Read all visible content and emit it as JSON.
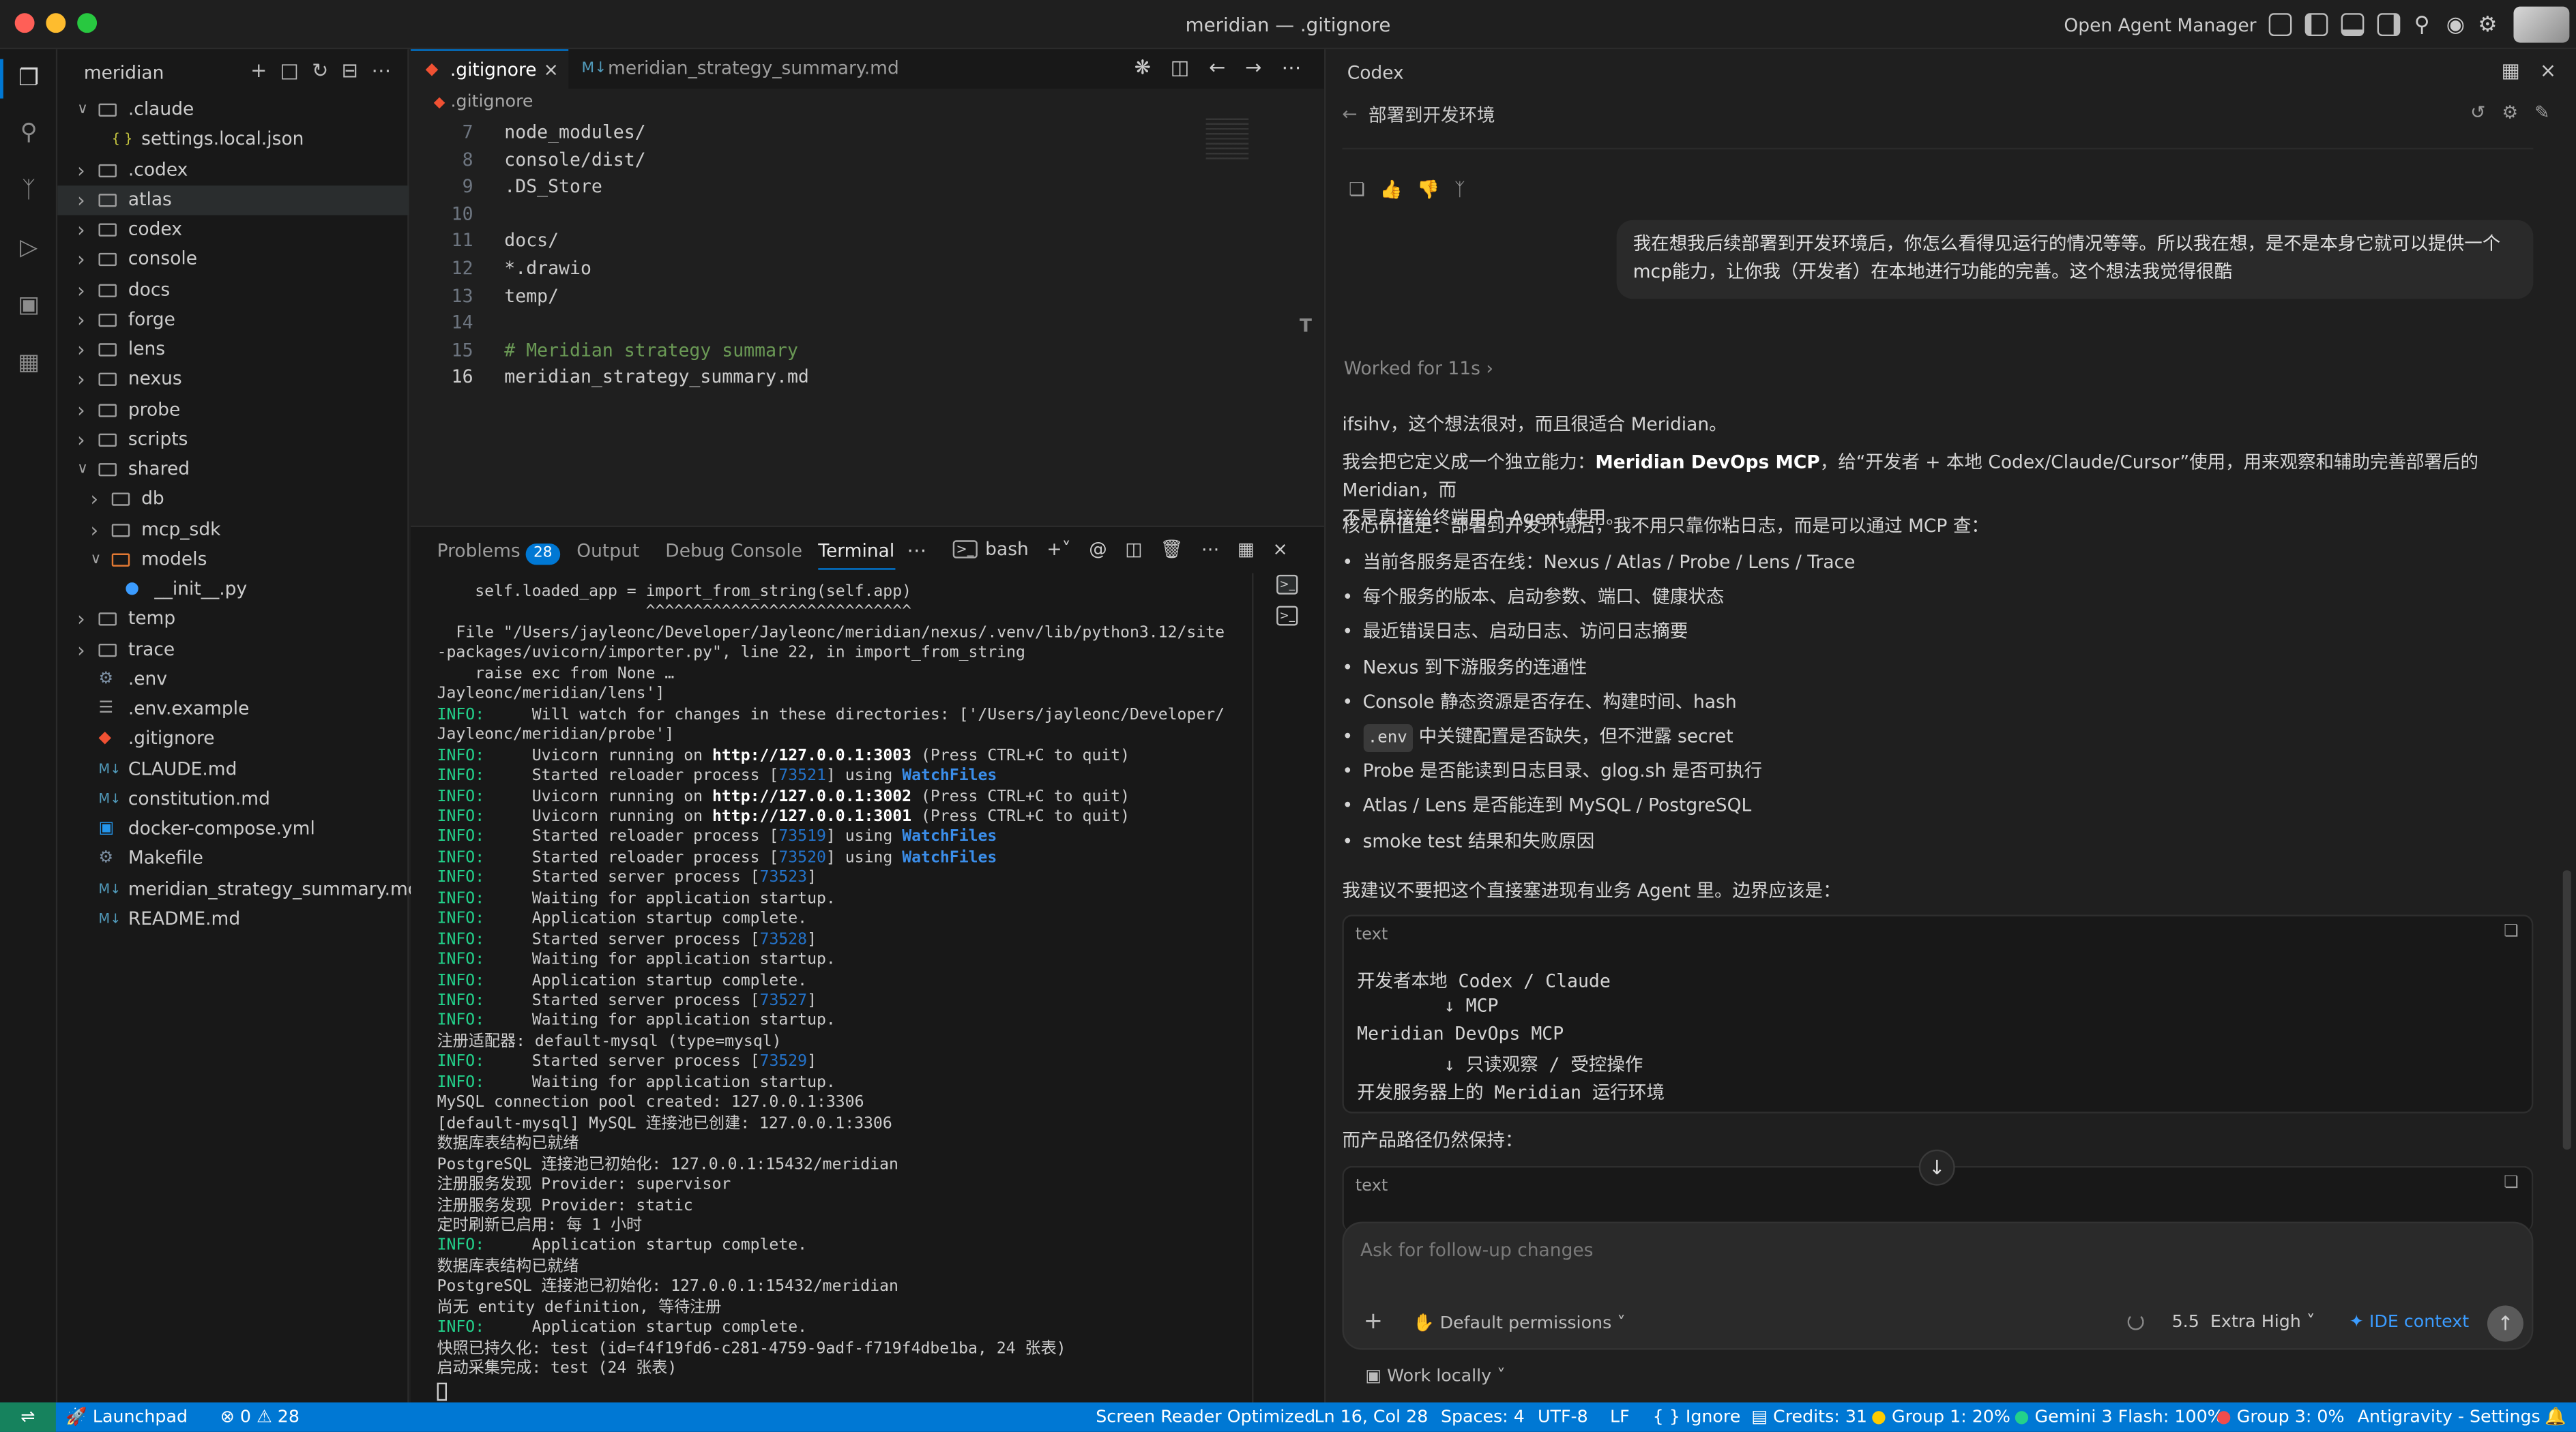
{
  "window": {
    "title": "meridian — .gitignore"
  },
  "titlebar": {
    "agent_manager": "Open Agent Manager"
  },
  "explorer": {
    "title": "meridian",
    "items": [
      {
        "label": ".claude",
        "icon": "folder-icon",
        "level": 0,
        "twisty": "v"
      },
      {
        "label": "settings.local.json",
        "icon": "json-file-icon",
        "level": 1,
        "twisty": ""
      },
      {
        "label": ".codex",
        "icon": "folder-icon",
        "level": 0,
        "twisty": ">"
      },
      {
        "label": "atlas",
        "icon": "folder-icon",
        "level": 0,
        "twisty": ">",
        "selected": true
      },
      {
        "label": "codex",
        "icon": "folder-icon",
        "level": 0,
        "twisty": ">"
      },
      {
        "label": "console",
        "icon": "folder-icon",
        "level": 0,
        "twisty": ">"
      },
      {
        "label": "docs",
        "icon": "folder-icon",
        "level": 0,
        "twisty": ">"
      },
      {
        "label": "forge",
        "icon": "folder-icon",
        "level": 0,
        "twisty": ">"
      },
      {
        "label": "lens",
        "icon": "folder-icon",
        "level": 0,
        "twisty": ">"
      },
      {
        "label": "nexus",
        "icon": "folder-icon",
        "level": 0,
        "twisty": ">"
      },
      {
        "label": "probe",
        "icon": "folder-icon",
        "level": 0,
        "twisty": ">"
      },
      {
        "label": "scripts",
        "icon": "folder-icon",
        "level": 0,
        "twisty": ">"
      },
      {
        "label": "shared",
        "icon": "folder-icon",
        "level": 0,
        "twisty": "v"
      },
      {
        "label": "db",
        "icon": "folder-icon",
        "level": 1,
        "twisty": ">"
      },
      {
        "label": "mcp_sdk",
        "icon": "folder-icon",
        "level": 1,
        "twisty": ">"
      },
      {
        "label": "models",
        "icon": "folder-icon",
        "level": 1,
        "twisty": "v"
      },
      {
        "label": "__init__.py",
        "icon": "python-file-icon",
        "level": 2,
        "twisty": ""
      },
      {
        "label": "temp",
        "icon": "folder-icon",
        "level": 0,
        "twisty": ">"
      },
      {
        "label": "trace",
        "icon": "folder-icon",
        "level": 0,
        "twisty": ">"
      },
      {
        "label": ".env",
        "icon": "gear-file-icon",
        "level": 0,
        "twisty": ""
      },
      {
        "label": ".env.example",
        "icon": "file-icon",
        "level": 0,
        "twisty": ""
      },
      {
        "label": ".gitignore",
        "icon": "git-file-icon",
        "level": 0,
        "twisty": ""
      },
      {
        "label": "CLAUDE.md",
        "icon": "markdown-file-icon",
        "level": 0,
        "twisty": ""
      },
      {
        "label": "constitution.md",
        "icon": "markdown-file-icon",
        "level": 0,
        "twisty": ""
      },
      {
        "label": "docker-compose.yml",
        "icon": "docker-file-icon",
        "level": 0,
        "twisty": ""
      },
      {
        "label": "Makefile",
        "icon": "gear-file-icon",
        "level": 0,
        "twisty": ""
      },
      {
        "label": "meridian_strategy_summary.md",
        "icon": "markdown-file-icon",
        "level": 0,
        "twisty": ""
      },
      {
        "label": "README.md",
        "icon": "markdown-file-icon",
        "level": 0,
        "twisty": ""
      }
    ]
  },
  "editor": {
    "tabs": [
      {
        "label": ".gitignore",
        "active": true
      },
      {
        "label": "meridian_strategy_summary.md",
        "active": false
      }
    ],
    "breadcrumb": ".gitignore",
    "lines": [
      {
        "n": "7",
        "text": "node_modules/"
      },
      {
        "n": "8",
        "text": "console/dist/"
      },
      {
        "n": "9",
        "text": ".DS_Store"
      },
      {
        "n": "10",
        "text": ""
      },
      {
        "n": "11",
        "text": "docs/"
      },
      {
        "n": "12",
        "text": "*.drawio"
      },
      {
        "n": "13",
        "text": "temp/"
      },
      {
        "n": "14",
        "text": ""
      },
      {
        "n": "15",
        "text": "# Meridian strategy summary",
        "comment": true
      },
      {
        "n": "16",
        "text": "meridian_strategy_summary.md",
        "current": true
      }
    ]
  },
  "panel": {
    "tabs": {
      "problems": "Problems",
      "problems_count": "28",
      "output": "Output",
      "debug": "Debug Console",
      "terminal": "Terminal",
      "shell": "bash"
    },
    "lines": [
      {
        "t": "    self.loaded_app = import_from_string(self.app)"
      },
      {
        "t": "                      ^^^^^^^^^^^^^^^^^^^^^^^^^^^^"
      },
      {
        "t": "  File \"/Users/jayleonc/Developer/Jayleonc/meridian/nexus/.venv/lib/python3.12/site"
      },
      {
        "t": "-packages/uvicorn/importer.py\", line 22, in import_from_string"
      },
      {
        "t": "    raise exc from None …"
      },
      {
        "t": "Jayleonc/meridian/lens']"
      },
      {
        "p": "INFO:",
        "t": "     Will watch for changes in these directories: ['/Users/jayleonc/Developer/"
      },
      {
        "t": "Jayleonc/meridian/probe']"
      },
      {
        "p": "INFO:",
        "t": "     Uvicorn running on ",
        "b": "http://127.0.0.1:3003",
        "r": " (Press CTRL+C to quit)"
      },
      {
        "p": "INFO:",
        "t": "     Started reloader process [",
        "n": "73521",
        "r": "] using ",
        "w": "WatchFiles"
      },
      {
        "p": "INFO:",
        "t": "     Uvicorn running on ",
        "b": "http://127.0.0.1:3002",
        "r": " (Press CTRL+C to quit)"
      },
      {
        "p": "INFO:",
        "t": "     Uvicorn running on ",
        "b": "http://127.0.0.1:3001",
        "r": " (Press CTRL+C to quit)"
      },
      {
        "p": "INFO:",
        "t": "     Started reloader process [",
        "n": "73519",
        "r": "] using ",
        "w": "WatchFiles"
      },
      {
        "p": "INFO:",
        "t": "     Started reloader process [",
        "n": "73520",
        "r": "] using ",
        "w": "WatchFiles"
      },
      {
        "p": "INFO:",
        "t": "     Started server process [",
        "n": "73523",
        "r": "]"
      },
      {
        "p": "INFO:",
        "t": "     Waiting for application startup."
      },
      {
        "p": "INFO:",
        "t": "     Application startup complete."
      },
      {
        "p": "INFO:",
        "t": "     Started server process [",
        "n": "73528",
        "r": "]"
      },
      {
        "p": "INFO:",
        "t": "     Waiting for application startup."
      },
      {
        "p": "INFO:",
        "t": "     Application startup complete."
      },
      {
        "p": "INFO:",
        "t": "     Started server process [",
        "n": "73527",
        "r": "]"
      },
      {
        "p": "INFO:",
        "t": "     Waiting for application startup."
      },
      {
        "t": "注册适配器: default-mysql (type=mysql)"
      },
      {
        "p": "INFO:",
        "t": "     Started server process [",
        "n": "73529",
        "r": "]"
      },
      {
        "p": "INFO:",
        "t": "     Waiting for application startup."
      },
      {
        "t": "MySQL connection pool created: 127.0.0.1:3306"
      },
      {
        "t": "[default-mysql] MySQL 连接池已创建: 127.0.0.1:3306"
      },
      {
        "t": "数据库表结构已就绪"
      },
      {
        "t": "PostgreSQL 连接池已初始化: 127.0.0.1:15432/meridian"
      },
      {
        "t": "注册服务发现 Provider: supervisor"
      },
      {
        "t": "注册服务发现 Provider: static"
      },
      {
        "t": "定时刷新已启用: 每 1 小时"
      },
      {
        "p": "INFO:",
        "t": "     Application startup complete."
      },
      {
        "t": "数据库表结构已就绪"
      },
      {
        "t": "PostgreSQL 连接池已初始化: 127.0.0.1:15432/meridian"
      },
      {
        "t": "尚无 entity definition, 等待注册"
      },
      {
        "p": "INFO:",
        "t": "     Application startup complete."
      },
      {
        "t": "快照已持久化: test (id=f4f19fd6-c281-4759-9adf-f719f4dbe1ba, 24 张表)"
      },
      {
        "t": "启动采集完成: test (24 张表)"
      }
    ]
  },
  "codex": {
    "title": "Codex",
    "thread": "部署到开发环境",
    "user_msg": "我在想我后续部署到开发环境后，你怎么看得见运行的情况等等。所以我在想，是不是本身它就可以提供一个mcp能力，让你我（开发者）在本地进行功能的完善。这个想法我觉得很酷",
    "worked": "Worked for 11s",
    "intro": "ifsihv，这个想法很对，而且很适合 Meridian。",
    "p1a": "我会把它定义成一个独立能力：",
    "p1b": "Meridian DevOps MCP",
    "p1c": "，给“开发者 + 本地 Codex/Claude/Cursor”使用，用来观察和辅助完善部署后的 Meridian，而",
    "p1d": "不是直接给终端用户 Agent 使用。",
    "p2": "核心价值是：部署到开发环境后，我不用只靠你粘日志，而是可以通过 MCP 查：",
    "bullets": [
      "当前各服务是否在线：Nexus / Atlas / Probe / Lens / Trace",
      "每个服务的版本、启动参数、端口、健康状态",
      "最近错误日志、启动日志、访问日志摘要",
      "Nexus 到下游服务的连通性",
      "Console 静态资源是否存在、构建时间、hash",
      "中关键配置是否缺失，但不泄露 secret",
      "Probe 是否能读到日志目录、glog.sh 是否可执行",
      "Atlas / Lens 是否能连到 MySQL / PostgreSQL",
      "smoke test 结果和失败原因"
    ],
    "env_chip": ".env",
    "p3": "我建议不要把这个直接塞进现有业务 Agent 里。边界应该是：",
    "code_label": "text",
    "code_lines": [
      "开发者本地 Codex / Claude",
      "        ↓ MCP",
      "Meridian DevOps MCP",
      "        ↓ 只读观察 / 受控操作",
      "开发服务器上的 Meridian 运行环境"
    ],
    "p4": "而产品路径仍然保持：",
    "code2_label": "text",
    "input_placeholder": "Ask for follow-up changes",
    "permissions": "Default permissions",
    "model": "5.5",
    "effort": "Extra High",
    "ide_context": "IDE context",
    "work_locally": "Work locally"
  },
  "statusbar": {
    "launchpad": "Launchpad",
    "errors": "0",
    "warnings": "28",
    "screen_reader": "Screen Reader Optimized",
    "position": "Ln 16, Col 28",
    "spaces": "Spaces: 4",
    "encoding": "UTF-8",
    "eol": "LF",
    "language": "Ignore",
    "credits": "Credits: 31",
    "group1": "Group 1: 20%",
    "gemini": "Gemini 3 Flash: 100%",
    "group3": "Group 3: 0%",
    "antigravity": "Antigravity - Settings"
  }
}
